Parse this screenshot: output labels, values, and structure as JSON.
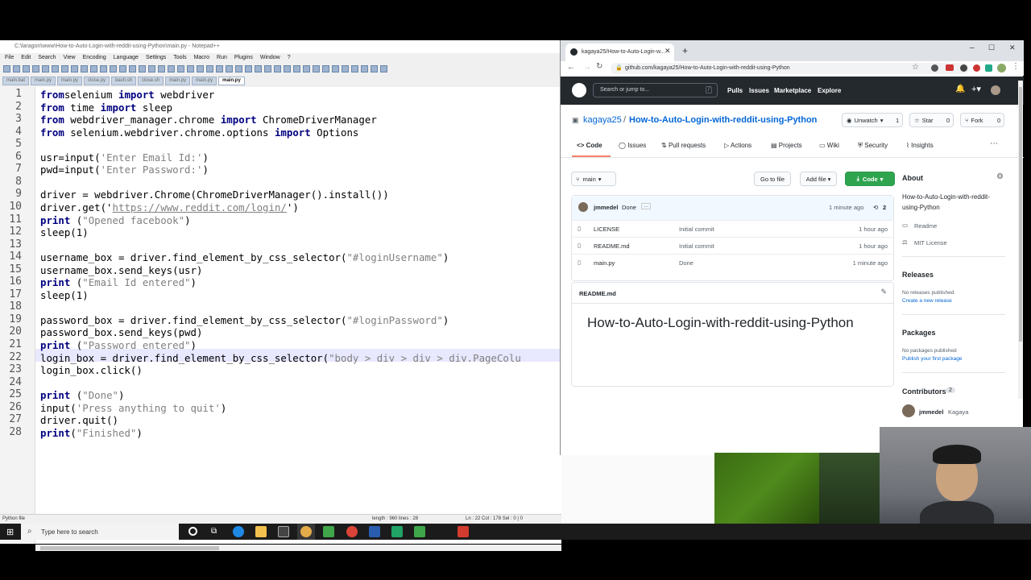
{
  "npp": {
    "title": "C:\\laragon\\www\\How-to-Auto-Login-with-reddit-using-Python\\main.py - Notepad++",
    "menu": [
      "File",
      "Edit",
      "Search",
      "View",
      "Encoding",
      "Language",
      "Settings",
      "Tools",
      "Macro",
      "Run",
      "Plugins",
      "Window",
      "?"
    ],
    "tabs": [
      "main.bat",
      "main.py",
      "main.py",
      "close.py",
      "bash.sh",
      "close.sh",
      "main.py",
      "main.py",
      "main.py"
    ],
    "active_tab": 8,
    "status": {
      "type": "Python file",
      "length": "length : 960   lines : 28",
      "pos": "Ln : 22   Col : 178   Sel : 0 | 0"
    }
  },
  "code_lines": [
    {
      "n": "1",
      "t": [
        [
          "kw",
          "from"
        ],
        [
          "",
          "selenium "
        ],
        [
          "kw",
          "import"
        ],
        [
          "",
          " webdriver"
        ]
      ]
    },
    {
      "n": "2",
      "t": [
        [
          "kw",
          "from"
        ],
        [
          "",
          " time "
        ],
        [
          "kw",
          "import"
        ],
        [
          "",
          " sleep"
        ]
      ]
    },
    {
      "n": "3",
      "t": [
        [
          "kw",
          "from"
        ],
        [
          "",
          " webdriver_manager.chrome "
        ],
        [
          "kw",
          "import"
        ],
        [
          "",
          " ChromeDriverManager"
        ]
      ]
    },
    {
      "n": "4",
      "t": [
        [
          "kw",
          "from"
        ],
        [
          "",
          " selenium.webdriver.chrome.options "
        ],
        [
          "kw",
          "import"
        ],
        [
          "",
          " Options"
        ]
      ]
    },
    {
      "n": "5",
      "t": []
    },
    {
      "n": "6",
      "t": [
        [
          "",
          "usr=input("
        ],
        [
          "str",
          "'Enter Email Id:'"
        ],
        [
          "",
          ")"
        ]
      ]
    },
    {
      "n": "7",
      "t": [
        [
          "",
          "pwd=input("
        ],
        [
          "str",
          "'Enter Password:'"
        ],
        [
          "",
          ")"
        ]
      ]
    },
    {
      "n": "8",
      "t": []
    },
    {
      "n": "9",
      "t": [
        [
          "",
          "driver = webdriver.Chrome(ChromeDriverManager().install())"
        ]
      ]
    },
    {
      "n": "10",
      "t": [
        [
          "",
          "driver.get('"
        ],
        [
          "url",
          "https://www.reddit.com/login/"
        ],
        [
          "",
          "')"
        ]
      ]
    },
    {
      "n": "11",
      "t": [
        [
          "kw",
          "print"
        ],
        [
          "",
          " ("
        ],
        [
          "str",
          "\"Opened facebook\""
        ],
        [
          "",
          ")"
        ]
      ]
    },
    {
      "n": "12",
      "t": [
        [
          "",
          "sleep(1)"
        ]
      ]
    },
    {
      "n": "13",
      "t": []
    },
    {
      "n": "14",
      "t": [
        [
          "",
          "username_box = driver.find_element_by_css_selector("
        ],
        [
          "str",
          "\"#loginUsername\""
        ],
        [
          "",
          ")"
        ]
      ]
    },
    {
      "n": "15",
      "t": [
        [
          "",
          "username_box.send_keys(usr)"
        ]
      ]
    },
    {
      "n": "16",
      "t": [
        [
          "kw",
          "print"
        ],
        [
          "",
          " ("
        ],
        [
          "str",
          "\"Email Id entered\""
        ],
        [
          "",
          ")"
        ]
      ]
    },
    {
      "n": "17",
      "t": [
        [
          "",
          "sleep(1)"
        ]
      ]
    },
    {
      "n": "18",
      "t": []
    },
    {
      "n": "19",
      "t": [
        [
          "",
          "password_box = driver.find_element_by_css_selector("
        ],
        [
          "str",
          "\"#loginPassword\""
        ],
        [
          "",
          ")"
        ]
      ]
    },
    {
      "n": "20",
      "t": [
        [
          "",
          "password_box.send_keys(pwd)"
        ]
      ]
    },
    {
      "n": "21",
      "t": [
        [
          "kw",
          "print"
        ],
        [
          "",
          " ("
        ],
        [
          "str",
          "\"Password entered\""
        ],
        [
          "",
          ")"
        ]
      ]
    },
    {
      "n": "22",
      "t": [
        [
          "",
          "login_box = driver.find_element_by_css_selector("
        ],
        [
          "str",
          "\"body > div > div > div.PageColu"
        ]
      ]
    },
    {
      "n": "23",
      "t": [
        [
          "",
          "login_box.click()"
        ]
      ]
    },
    {
      "n": "24",
      "t": []
    },
    {
      "n": "25",
      "t": [
        [
          "kw",
          "print"
        ],
        [
          "",
          " ("
        ],
        [
          "str",
          "\"Done\""
        ],
        [
          "",
          ")"
        ]
      ]
    },
    {
      "n": "26",
      "t": [
        [
          "",
          "input("
        ],
        [
          "str",
          "'Press anything to quit'"
        ],
        [
          "",
          ")"
        ]
      ]
    },
    {
      "n": "27",
      "t": [
        [
          "",
          "driver.quit()"
        ]
      ]
    },
    {
      "n": "28",
      "t": [
        [
          "kw",
          "print"
        ],
        [
          "",
          "("
        ],
        [
          "str",
          "\"Finished\""
        ],
        [
          "",
          ")"
        ]
      ]
    }
  ],
  "browser": {
    "tab_title": "kagaya25/How-to-Auto-Login-w...",
    "url": "github.com/kagaya25/How-to-Auto-Login-with-reddit-using-Python",
    "search_placeholder": "Search or jump to...",
    "search_key": "/",
    "nav": [
      "Pulls",
      "Issues",
      "Marketplace",
      "Explore"
    ],
    "owner": "kagaya25",
    "repo": "How-to-Auto-Login-with-reddit-using-Python",
    "unwatch": "Unwatch",
    "unwatch_count": "1",
    "star": "Star",
    "star_count": "0",
    "fork": "Fork",
    "fork_count": "0",
    "tabs": [
      "Code",
      "Issues",
      "Pull requests",
      "Actions",
      "Projects",
      "Wiki",
      "Security",
      "Insights"
    ],
    "branch": "main",
    "goto_file": "Go to file",
    "add_file": "Add file",
    "code_btn": "Code",
    "commit_author": "jmmedel",
    "commit_msg": "Done",
    "commit_time": "1 minute ago",
    "commit_count": "2",
    "files": [
      {
        "name": "LICENSE",
        "msg": "Initial commit",
        "time": "1 hour ago"
      },
      {
        "name": "README.md",
        "msg": "Initial commit",
        "time": "1 hour ago"
      },
      {
        "name": "main.py",
        "msg": "Done",
        "time": "1 minute ago"
      }
    ],
    "readme_label": "README.md",
    "readme_heading": "How-to-Auto-Login-with-reddit-using-Python",
    "about": "About",
    "about_desc": "How-to-Auto-Login-with-reddit-using-Python",
    "readme_link": "Readme",
    "license_link": "MIT License",
    "releases": "Releases",
    "no_releases": "No releases published",
    "create_release": "Create a new release",
    "packages": "Packages",
    "no_packages": "No packages published",
    "publish_package": "Publish your first package",
    "contributors": "Contributors",
    "contributors_count": "2",
    "contributor1": "jmmedel",
    "contributor1_name": "Kagaya"
  },
  "taskbar": {
    "search": "Type here to search"
  }
}
